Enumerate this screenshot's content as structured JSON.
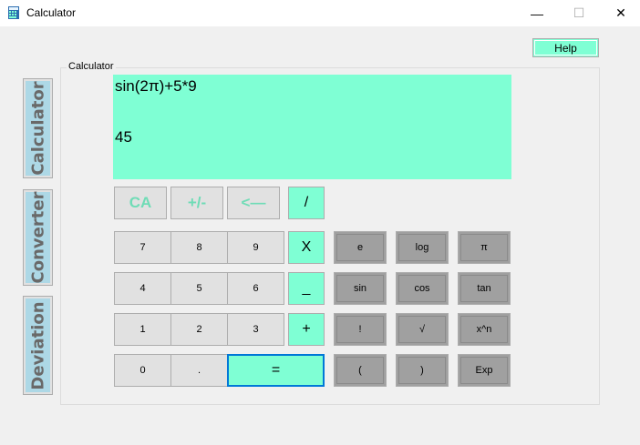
{
  "window": {
    "title": "Calculator",
    "controls": {
      "minimize": "—",
      "maximize": "☐",
      "close": "✕"
    }
  },
  "help_label": "Help",
  "side_tabs": [
    "Calculator",
    "Converter",
    "Deviation"
  ],
  "group_label": "Calculator",
  "display": {
    "expression": "sin(2π)+5*9",
    "result": "45"
  },
  "buttons": {
    "clear": "CA",
    "sign": "+/-",
    "backspace": "<—",
    "divide": "/",
    "multiply": "X",
    "subtract": "_",
    "add": "+",
    "equals": "=",
    "digits": {
      "d7": "7",
      "d8": "8",
      "d9": "9",
      "d4": "4",
      "d5": "5",
      "d6": "6",
      "d1": "1",
      "d2": "2",
      "d3": "3",
      "d0": "0",
      "dot": "."
    },
    "functions": {
      "e": "e",
      "log": "log",
      "pi": "π",
      "sin": "sin",
      "cos": "cos",
      "tan": "tan",
      "fact": "!",
      "sqrt": "√",
      "pow": "x^n",
      "lparen": "(",
      "rparen": ")",
      "exp": "Exp"
    }
  },
  "colors": {
    "accent": "#7fffd4",
    "tab_fill": "#add8e6",
    "function_button": "#a0a0a0",
    "focus_border": "#0078d7"
  }
}
